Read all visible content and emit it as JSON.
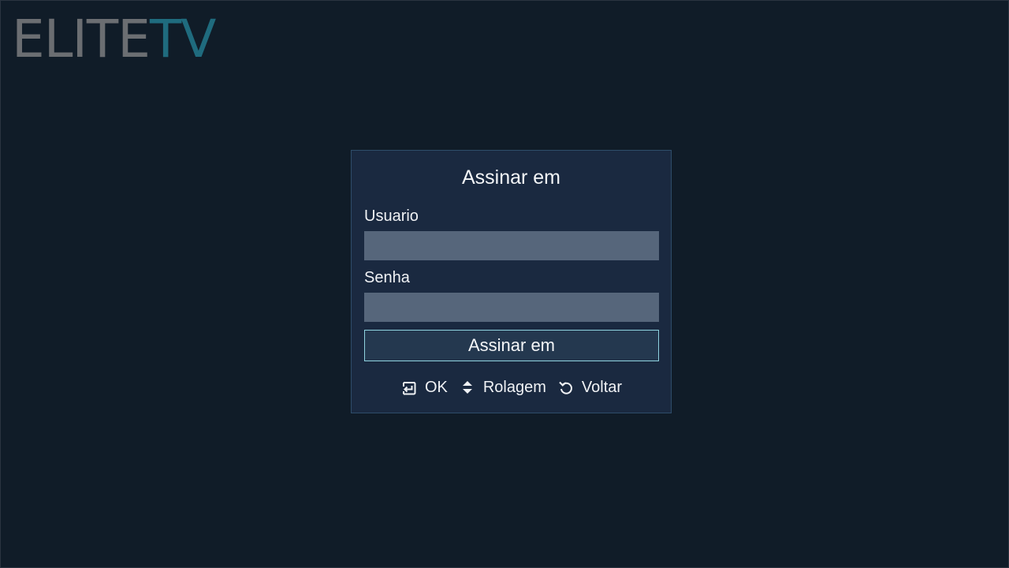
{
  "logo": {
    "part_a": "ELITE",
    "part_b": "TV",
    "color_a": "#6b6e72",
    "color_b": "#1f6b7e"
  },
  "dialog": {
    "title": "Assinar em",
    "username_label": "Usuario",
    "username_value": "",
    "password_label": "Senha",
    "password_value": "",
    "submit_label": "Assinar em"
  },
  "hints": [
    {
      "icon": "enter-icon",
      "label": "OK"
    },
    {
      "icon": "up-down-arrows-icon",
      "label": "Rolagem"
    },
    {
      "icon": "back-arrow-icon",
      "label": "Voltar"
    }
  ],
  "colors": {
    "background": "#101c28",
    "dialog_background": "#1a2940",
    "field_background": "#56667b",
    "button_focus_border": "#8fd3e0"
  }
}
